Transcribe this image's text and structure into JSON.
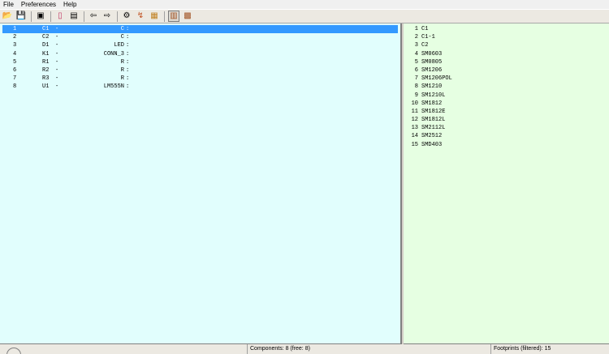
{
  "menubar": {
    "items": [
      "File",
      "Preferences",
      "Help"
    ]
  },
  "toolbar": {
    "icons": [
      {
        "name": "open-folder-icon",
        "glyph": "📂"
      },
      {
        "name": "save-icon",
        "glyph": "💾"
      },
      {
        "name": "config-icon",
        "glyph": "▣"
      },
      {
        "name": "module-editor-icon",
        "glyph": "▯"
      },
      {
        "name": "create-stuff-file-icon",
        "glyph": "▤"
      },
      {
        "name": "arrow-left-icon",
        "glyph": "⇦"
      },
      {
        "name": "arrow-right-icon",
        "glyph": "⇨"
      },
      {
        "name": "auto-associate-icon",
        "glyph": "⚙"
      },
      {
        "name": "delete-associations-icon",
        "glyph": "↯"
      },
      {
        "name": "pdf-doc-icon",
        "glyph": "▦"
      },
      {
        "name": "filter-keyword-icon",
        "glyph": "▥"
      },
      {
        "name": "filter-pincount-icon",
        "glyph": "▩"
      }
    ]
  },
  "components": [
    {
      "index": "1",
      "ref": "C1",
      "dash": "-",
      "value": "C",
      "footprint": ":"
    },
    {
      "index": "2",
      "ref": "C2",
      "dash": "-",
      "value": "C",
      "footprint": ":"
    },
    {
      "index": "3",
      "ref": "D1",
      "dash": "-",
      "value": "LED",
      "footprint": ":"
    },
    {
      "index": "4",
      "ref": "K1",
      "dash": "-",
      "value": "CONN_3",
      "footprint": ":"
    },
    {
      "index": "5",
      "ref": "R1",
      "dash": "-",
      "value": "R",
      "footprint": ":"
    },
    {
      "index": "6",
      "ref": "R2",
      "dash": "-",
      "value": "R",
      "footprint": ":"
    },
    {
      "index": "7",
      "ref": "R3",
      "dash": "-",
      "value": "R",
      "footprint": ":"
    },
    {
      "index": "8",
      "ref": "U1",
      "dash": "-",
      "value": "LM555N",
      "footprint": ":"
    }
  ],
  "footprints": [
    {
      "index": "1",
      "name": "C1"
    },
    {
      "index": "2",
      "name": "C1-1"
    },
    {
      "index": "3",
      "name": "C2"
    },
    {
      "index": "4",
      "name": "SM0603"
    },
    {
      "index": "5",
      "name": "SM0805"
    },
    {
      "index": "6",
      "name": "SM1206"
    },
    {
      "index": "7",
      "name": "SM1206POL"
    },
    {
      "index": "8",
      "name": "SM1210"
    },
    {
      "index": "9",
      "name": "SM1210L"
    },
    {
      "index": "10",
      "name": "SM1812"
    },
    {
      "index": "11",
      "name": "SM1812E"
    },
    {
      "index": "12",
      "name": "SM1812L"
    },
    {
      "index": "13",
      "name": "SM2112L"
    },
    {
      "index": "14",
      "name": "SM2512"
    },
    {
      "index": "15",
      "name": "SMD403"
    }
  ],
  "statusbar": {
    "components": "Components: 8 (free: 8)",
    "footprints": "Footprints (filtered): 15"
  },
  "colors": {
    "selection": "#3399ff",
    "components_bg": "#e1fefd",
    "footprints_bg": "#e6ffe2"
  }
}
